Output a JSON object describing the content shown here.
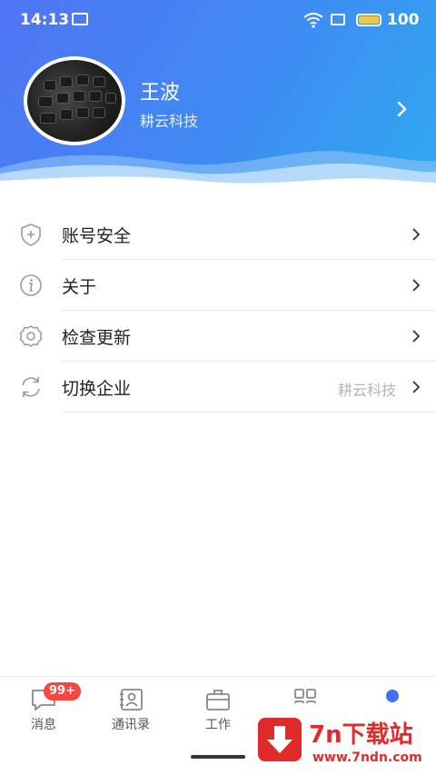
{
  "status_bar": {
    "time": "14:13",
    "battery": "100"
  },
  "profile": {
    "name": "王波",
    "company": "耕云科技"
  },
  "menu": [
    {
      "label": "账号安全",
      "value": "",
      "icon": "shield-plus-icon"
    },
    {
      "label": "关于",
      "value": "",
      "icon": "info-icon"
    },
    {
      "label": "检查更新",
      "value": "",
      "icon": "gear-icon"
    },
    {
      "label": "切换企业",
      "value": "耕云科技",
      "icon": "refresh-icon"
    }
  ],
  "tabs": [
    {
      "label": "消息",
      "badge": "99+",
      "icon": "message-icon"
    },
    {
      "label": "通讯录",
      "badge": "",
      "icon": "contacts-icon"
    },
    {
      "label": "工作",
      "badge": "",
      "icon": "briefcase-icon"
    },
    {
      "label": "",
      "badge": "",
      "icon": "apps-grid-icon"
    },
    {
      "label": "",
      "badge": "",
      "icon": "user-icon",
      "active": true
    }
  ],
  "watermark": {
    "title": "7n下载站",
    "url": "www.7ndn.com"
  },
  "colors": {
    "header_start": "#4f74f5",
    "header_end": "#2fa9f0",
    "badge": "#f4473e",
    "accent": "#3f72f0"
  }
}
